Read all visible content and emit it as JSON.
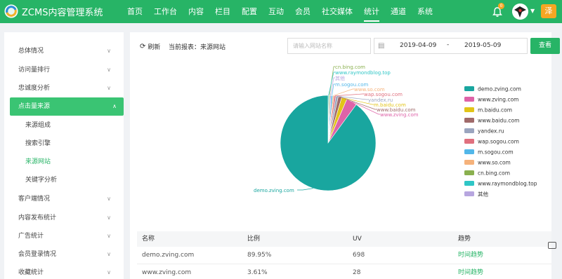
{
  "app": {
    "title": "ZCMS内容管理系统"
  },
  "nav": [
    {
      "label": "首页"
    },
    {
      "label": "工作台"
    },
    {
      "label": "内容"
    },
    {
      "label": "栏目"
    },
    {
      "label": "配置"
    },
    {
      "label": "互动"
    },
    {
      "label": "会员"
    },
    {
      "label": "社交媒体"
    },
    {
      "label": "统计"
    },
    {
      "label": "通道"
    },
    {
      "label": "系统"
    }
  ],
  "nav_active": "统计",
  "user": {
    "notification_count": "0",
    "name_badge": "泽"
  },
  "sidebar": {
    "items": [
      {
        "label": "总体情况"
      },
      {
        "label": "访问量排行"
      },
      {
        "label": "忠诚度分析"
      },
      {
        "label": "点击量来源"
      },
      {
        "label": "客户端情况"
      },
      {
        "label": "内容发布统计"
      },
      {
        "label": "广告统计"
      },
      {
        "label": "会员登录情况"
      },
      {
        "label": "收藏统计"
      }
    ],
    "subitems": [
      {
        "label": "来源组成"
      },
      {
        "label": "搜索引擎"
      },
      {
        "label": "来源网站"
      },
      {
        "label": "关键字分析"
      }
    ]
  },
  "toolbar": {
    "refresh_label": "刷新",
    "report_label": "当前报表：来源网站",
    "search_placeholder": "请输入网站名称",
    "date_start": "2019-04-09",
    "date_sep": "-",
    "date_end": "2019-05-09",
    "search_button": "查看"
  },
  "chart_data": {
    "type": "pie",
    "categories": [
      "demo.zving.com",
      "www.zving.com",
      "m.baidu.com",
      "www.baidu.com",
      "yandex.ru",
      "wap.sogou.com",
      "m.sogou.com",
      "www.so.com",
      "cn.bing.com",
      "www.raymondblog.top",
      "其他"
    ],
    "values": [
      89.95,
      3.61,
      1.8,
      1.2,
      0.8,
      0.6,
      0.55,
      0.45,
      0.35,
      0.3,
      0.39
    ],
    "colors": [
      "#19a69f",
      "#de63a8",
      "#e2c418",
      "#a06a6a",
      "#9ba5bf",
      "#e0707e",
      "#52b7e9",
      "#f5b27b",
      "#8ab04f",
      "#2fc6c6",
      "#b7a6df"
    ],
    "legend_placement": "right"
  },
  "table": {
    "headers": [
      "名称",
      "比例",
      "UV",
      "趋势"
    ],
    "rows": [
      [
        "demo.zving.com",
        "89.95%",
        "698",
        "时间趋势"
      ],
      [
        "www.zving.com",
        "3.61%",
        "28",
        "时间趋势"
      ]
    ]
  }
}
